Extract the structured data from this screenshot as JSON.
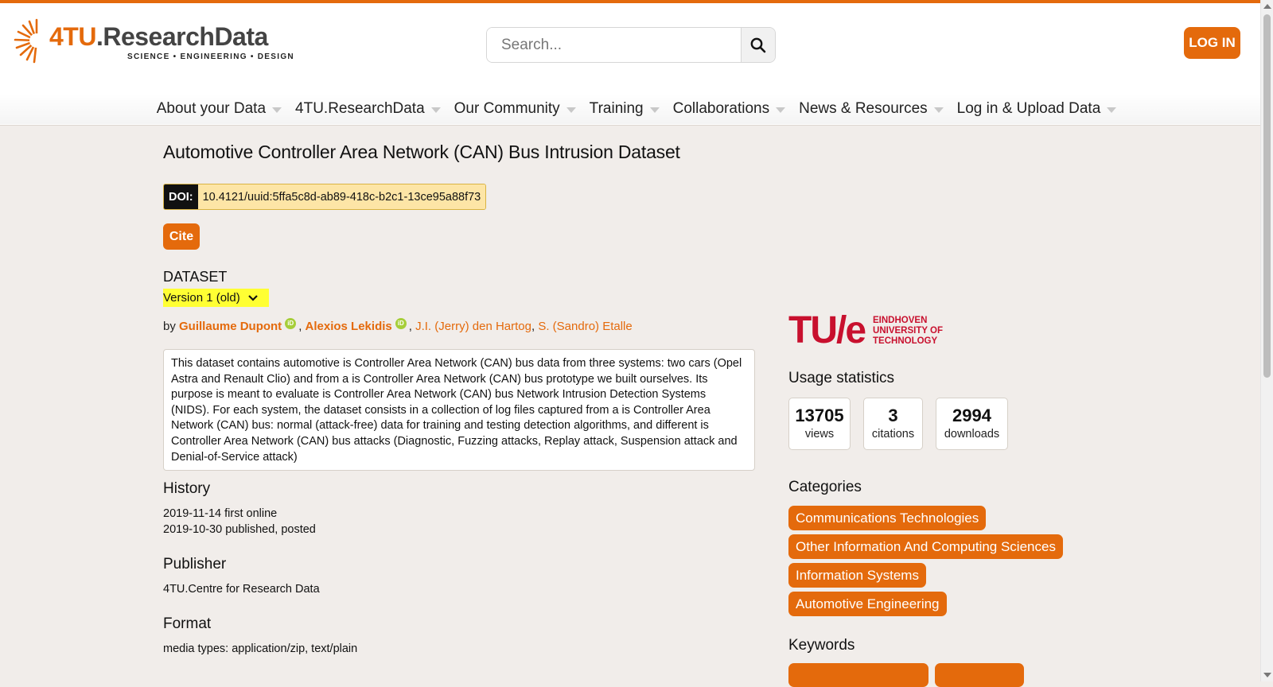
{
  "header": {
    "logo": {
      "number": "4TU",
      "name": ".ResearchData",
      "tagline": "SCIENCE • ENGINEERING • DESIGN"
    },
    "search": {
      "placeholder": "Search..."
    },
    "login_label": "LOG IN"
  },
  "nav": {
    "items": [
      {
        "label": "About your Data"
      },
      {
        "label": "4TU.ResearchData"
      },
      {
        "label": "Our Community"
      },
      {
        "label": "Training"
      },
      {
        "label": "Collaborations"
      },
      {
        "label": "News & Resources"
      },
      {
        "label": "Log in & Upload Data"
      }
    ]
  },
  "dataset": {
    "title": "Automotive Controller Area Network (CAN) Bus Intrusion Dataset",
    "doi_label": "DOI:",
    "doi_value": "10.4121/uuid:5ffa5c8d-ab89-418c-b2c1-13ce95a88f73",
    "cite_label": "Cite",
    "type_label": "DATASET",
    "version_label": "Version 1 (old)",
    "by_label": "by",
    "authors": [
      {
        "name": "Guillaume Dupont"
      },
      {
        "name": "Alexios Lekidis"
      },
      {
        "name": "J.I. (Jerry) den Hartog"
      },
      {
        "name": "S. (Sandro) Etalle"
      }
    ],
    "description": "This dataset contains automotive is Controller Area Network (CAN) bus data from three systems: two cars (Opel Astra and Renault Clio) and from a is Controller Area Network (CAN) bus prototype we built ourselves. Its purpose is meant to evaluate is Controller Area Network (CAN) bus Network Intrusion Detection Systems (NIDS). For each system, the dataset consists in a collection of log files captured from a is Controller Area Network (CAN) bus: normal (attack-free) data for training and testing detection algorithms, and different is Controller Area Network (CAN) bus attacks (Diagnostic, Fuzzing attacks, Replay attack, Suspension attack and Denial-of-Service attack)",
    "history_heading": "History",
    "history": [
      "2019-11-14 first online",
      "2019-10-30 published, posted"
    ],
    "publisher_heading": "Publisher",
    "publisher": "4TU.Centre for Research Data",
    "format_heading": "Format",
    "format": "media types: application/zip, text/plain"
  },
  "sidebar": {
    "institution": {
      "mark": "TU/e",
      "line1": "EINDHOVEN",
      "line2": "UNIVERSITY OF",
      "line3": "TECHNOLOGY"
    },
    "usage_heading": "Usage statistics",
    "stats": [
      {
        "value": "13705",
        "label": "views"
      },
      {
        "value": "3",
        "label": "citations"
      },
      {
        "value": "2994",
        "label": "downloads"
      }
    ],
    "categories_heading": "Categories",
    "categories": [
      "Communications Technologies",
      "Other Information And Computing Sciences",
      "Information Systems",
      "Automotive Engineering"
    ],
    "keywords_heading": "Keywords"
  },
  "colors": {
    "accent": "#e46a0c",
    "doi_highlight": "#fde5a6",
    "version_highlight": "#ffff33",
    "orcid": "#a6ce39",
    "institution": "#c8102e"
  },
  "icons": [
    "logo-sunburst-icon",
    "search-icon",
    "caret-down-icon",
    "chevron-down-icon",
    "orcid-icon"
  ]
}
